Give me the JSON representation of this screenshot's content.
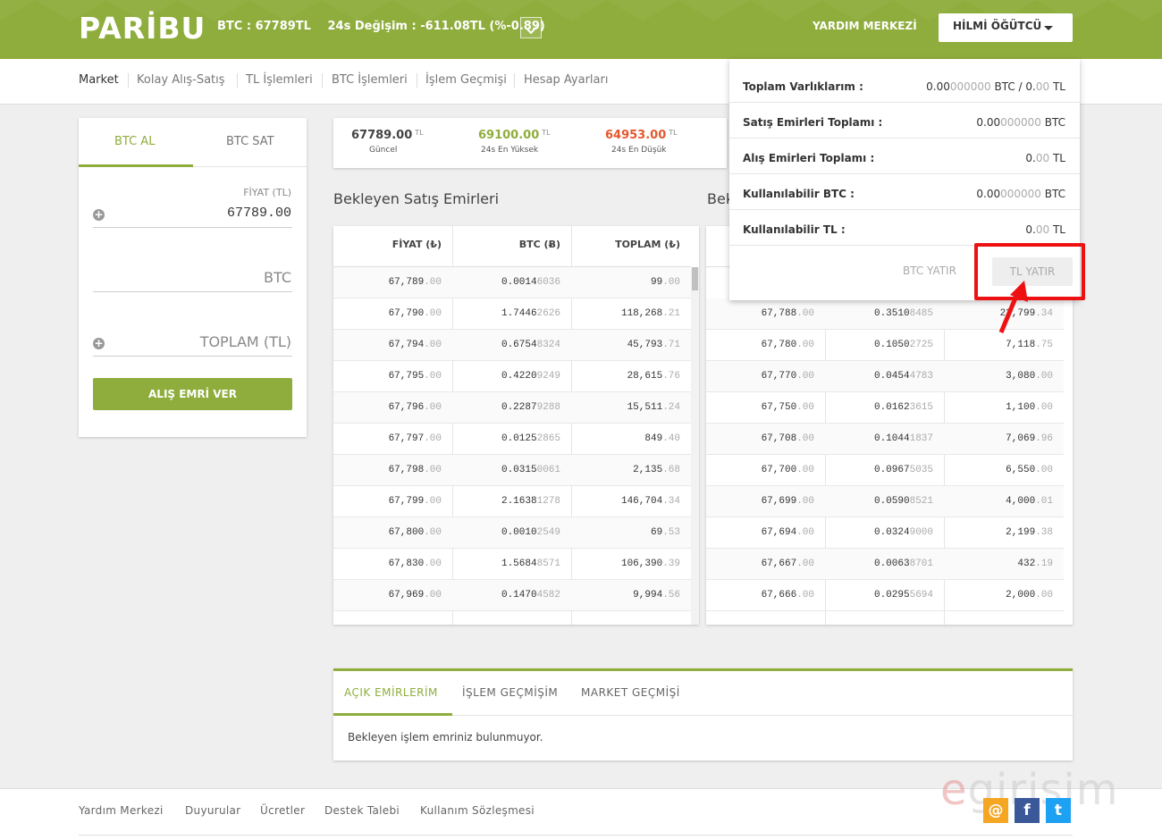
{
  "header": {
    "logo": "PARİBU",
    "ticker_price": "BTC : 67789TL",
    "ticker_change": "24s Değişim : -611.08TL (%-0.89)",
    "help": "YARDIM MERKEZİ",
    "user": "HİLMİ ÖĞÜTCÜ"
  },
  "nav": [
    "Market",
    "Kolay Alış-Satış",
    "TL İşlemleri",
    "BTC İşlemleri",
    "İşlem Geçmişi",
    "Hesap Ayarları"
  ],
  "order_form": {
    "tab_buy": "BTC AL",
    "tab_sell": "BTC SAT",
    "price_label": "FİYAT (TL)",
    "price_value": "67789.00",
    "amount_placeholder": "BTC",
    "total_placeholder": "TOPLAM (TL)",
    "submit": "ALIŞ EMRİ VER"
  },
  "stats": [
    {
      "value": "67789.00",
      "unit": "TL",
      "label": "Güncel",
      "color": "#444444"
    },
    {
      "value": "69100.00",
      "unit": "TL",
      "label": "24s En Yüksek",
      "color": "#8fad3c"
    },
    {
      "value": "64953.00",
      "unit": "TL",
      "label": "24s En Düşük",
      "color": "#e4572e"
    }
  ],
  "sell_orders": {
    "title": "Bekleyen Satış Emirleri",
    "headers": [
      "FİYAT (₺)",
      "BTC (Ƀ)",
      "TOPLAM (₺)"
    ],
    "rows": [
      [
        "67,789",
        ".00",
        "0.0014",
        "6036",
        "99",
        ".00"
      ],
      [
        "67,790",
        ".00",
        "1.7446",
        "2626",
        "118,268",
        ".21"
      ],
      [
        "67,794",
        ".00",
        "0.6754",
        "8324",
        "45,793",
        ".71"
      ],
      [
        "67,795",
        ".00",
        "0.4220",
        "9249",
        "28,615",
        ".76"
      ],
      [
        "67,796",
        ".00",
        "0.2287",
        "9288",
        "15,511",
        ".24"
      ],
      [
        "67,797",
        ".00",
        "0.0125",
        "2865",
        "849",
        ".40"
      ],
      [
        "67,798",
        ".00",
        "0.0315",
        "0061",
        "2,135",
        ".68"
      ],
      [
        "67,799",
        ".00",
        "2.1638",
        "1278",
        "146,704",
        ".34"
      ],
      [
        "67,800",
        ".00",
        "0.0010",
        "2549",
        "69",
        ".53"
      ],
      [
        "67,830",
        ".00",
        "1.5684",
        "8571",
        "106,390",
        ".39"
      ],
      [
        "67,969",
        ".00",
        "0.1470",
        "4582",
        "9,994",
        ".56"
      ]
    ]
  },
  "buy_orders": {
    "title": "Bek",
    "rows": [
      [
        "67,788",
        ".00",
        "0.3510",
        "8485",
        "23,799",
        ".34"
      ],
      [
        "67,780",
        ".00",
        "0.1050",
        "2725",
        "7,118",
        ".75"
      ],
      [
        "67,770",
        ".00",
        "0.0454",
        "4783",
        "3,080",
        ".00"
      ],
      [
        "67,750",
        ".00",
        "0.0162",
        "3615",
        "1,100",
        ".00"
      ],
      [
        "67,708",
        ".00",
        "0.1044",
        "1837",
        "7,069",
        ".96"
      ],
      [
        "67,700",
        ".00",
        "0.0967",
        "5035",
        "6,550",
        ".00"
      ],
      [
        "67,699",
        ".00",
        "0.0590",
        "8521",
        "4,000",
        ".01"
      ],
      [
        "67,694",
        ".00",
        "0.0324",
        "9000",
        "2,199",
        ".38"
      ],
      [
        "67,667",
        ".00",
        "0.0063",
        "8701",
        "432",
        ".19"
      ],
      [
        "67,666",
        ".00",
        "0.0295",
        "5694",
        "2,000",
        ".00"
      ]
    ]
  },
  "account": {
    "rows": [
      {
        "label": "Toplam Varlıklarım :",
        "v1": "0.00",
        "v2": "000000",
        "v3": " BTC / 0.",
        "v4": "00",
        "v5": " TL"
      },
      {
        "label": "Satış Emirleri Toplamı :",
        "v1": "0.00",
        "v2": "000000",
        "v3": " BTC",
        "v4": "",
        "v5": ""
      },
      {
        "label": "Alış Emirleri Toplamı :",
        "v1": "0.",
        "v2": "00",
        "v3": " TL",
        "v4": "",
        "v5": ""
      },
      {
        "label": "Kullanılabilir BTC :",
        "v1": "0.00",
        "v2": "000000",
        "v3": " BTC",
        "v4": "",
        "v5": ""
      },
      {
        "label": "Kullanılabilir TL :",
        "v1": "0.",
        "v2": "00",
        "v3": " TL",
        "v4": "",
        "v5": ""
      }
    ],
    "btc_deposit": "BTC YATIR",
    "tl_deposit": "TL YATIR"
  },
  "bottom_tabs": {
    "tabs": [
      "AÇIK EMİRLERİM",
      "İŞLEM GEÇMİŞİM",
      "MARKET GEÇMİŞİ"
    ],
    "empty": "Bekleyen işlem emriniz bulunmuyor."
  },
  "footer": [
    "Yardım Merkezi",
    "Duyurular",
    "Ücretler",
    "Destek Talebi",
    "Kullanım Sözleşmesi"
  ],
  "watermark": {
    "e": "e",
    "rest": "girisim"
  },
  "social": {
    "email": "@",
    "facebook": "f",
    "twitter": "t"
  },
  "colors": {
    "brand": "#8fad3c",
    "highlight": "#ee1111",
    "down": "#e4572e"
  }
}
